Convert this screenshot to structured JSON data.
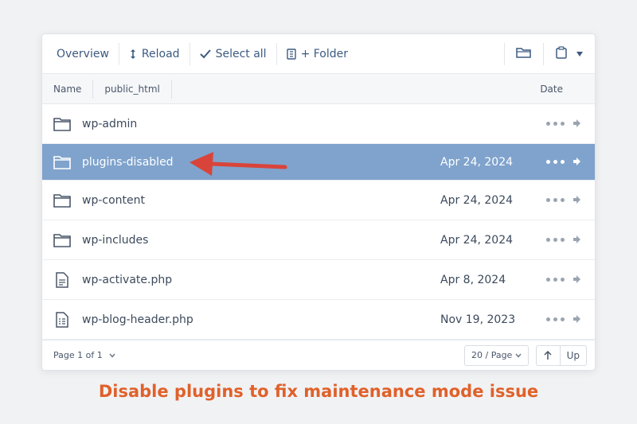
{
  "toolbar": {
    "overview": "Overview",
    "reload": "Reload",
    "select_all": "Select all",
    "folder": "+ Folder",
    "icons": [
      "reload-icon",
      "check-icon",
      "archive-icon",
      "folder-open-icon",
      "clipboard-icon",
      "chevron-down-icon"
    ]
  },
  "header": {
    "name": "Name",
    "path": "public_html",
    "date": "Date"
  },
  "rows": [
    {
      "name": "wp-admin",
      "date": "",
      "type": "folder",
      "selected": false
    },
    {
      "name": "plugins-disabled",
      "date": "Apr 24, 2024",
      "type": "folder",
      "selected": true
    },
    {
      "name": "wp-content",
      "date": "Apr 24, 2024",
      "type": "folder",
      "selected": false
    },
    {
      "name": "wp-includes",
      "date": "Apr 24, 2024",
      "type": "folder",
      "selected": false
    },
    {
      "name": "wp-activate.php",
      "date": "Apr 8, 2024",
      "type": "file",
      "selected": false
    },
    {
      "name": "wp-blog-header.php",
      "date": "Nov 19, 2023",
      "type": "file",
      "selected": false
    }
  ],
  "footer": {
    "page": "Page 1 of 1",
    "per_page": "20 / Page",
    "up": "Up"
  },
  "caption": "Disable plugins to fix maintenance mode issue",
  "colors": {
    "selected_row": "#7fa3cc",
    "arrow": "#d9443a",
    "caption": "#e0612a",
    "toolbar_text": "#3c5a80"
  }
}
